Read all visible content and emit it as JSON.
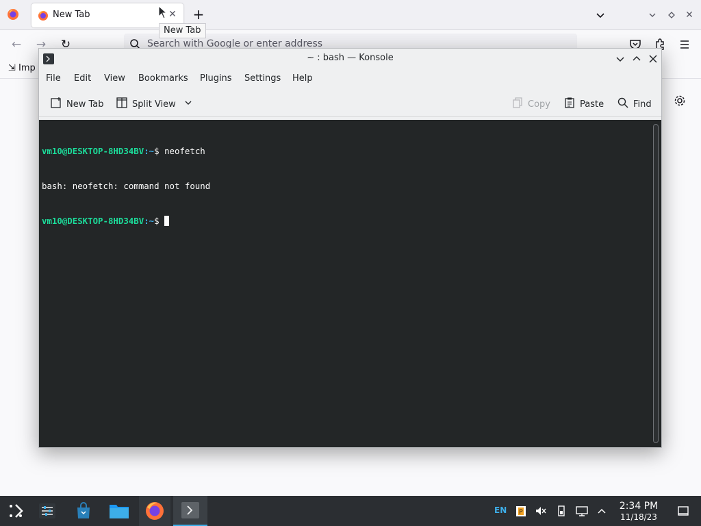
{
  "browser": {
    "tab_title": "New Tab",
    "tab_tooltip": "New Tab",
    "url_placeholder": "Search with Google or enter address",
    "bookmark_import_label": "Imp"
  },
  "konsole": {
    "title": "~ : bash — Konsole",
    "menu": [
      "File",
      "Edit",
      "View",
      "Bookmarks",
      "Plugins",
      "Settings",
      "Help"
    ],
    "toolbar": {
      "new_tab": "New Tab",
      "split_view": "Split View",
      "copy": "Copy",
      "paste": "Paste",
      "find": "Find"
    },
    "terminal": {
      "prompt_user": "vm10@DESKTOP-8HD34BV",
      "prompt_sep": ":",
      "prompt_path": "~",
      "prompt_symbol": "$ ",
      "command1": "neofetch",
      "output1": "bash: neofetch: command not found"
    }
  },
  "taskbar": {
    "language": "EN",
    "time": "2:34 PM",
    "date": "11/18/23",
    "pinned": [
      "application-launcher-icon",
      "system-settings-icon",
      "discover-store-icon",
      "file-manager-icon",
      "firefox-icon",
      "konsole-icon"
    ]
  },
  "colors": {
    "prompt_user": "#1cdc9a",
    "prompt_path": "#3daee9",
    "terminal_bg": "#232627",
    "taskbar_bg": "#2b2e32"
  }
}
